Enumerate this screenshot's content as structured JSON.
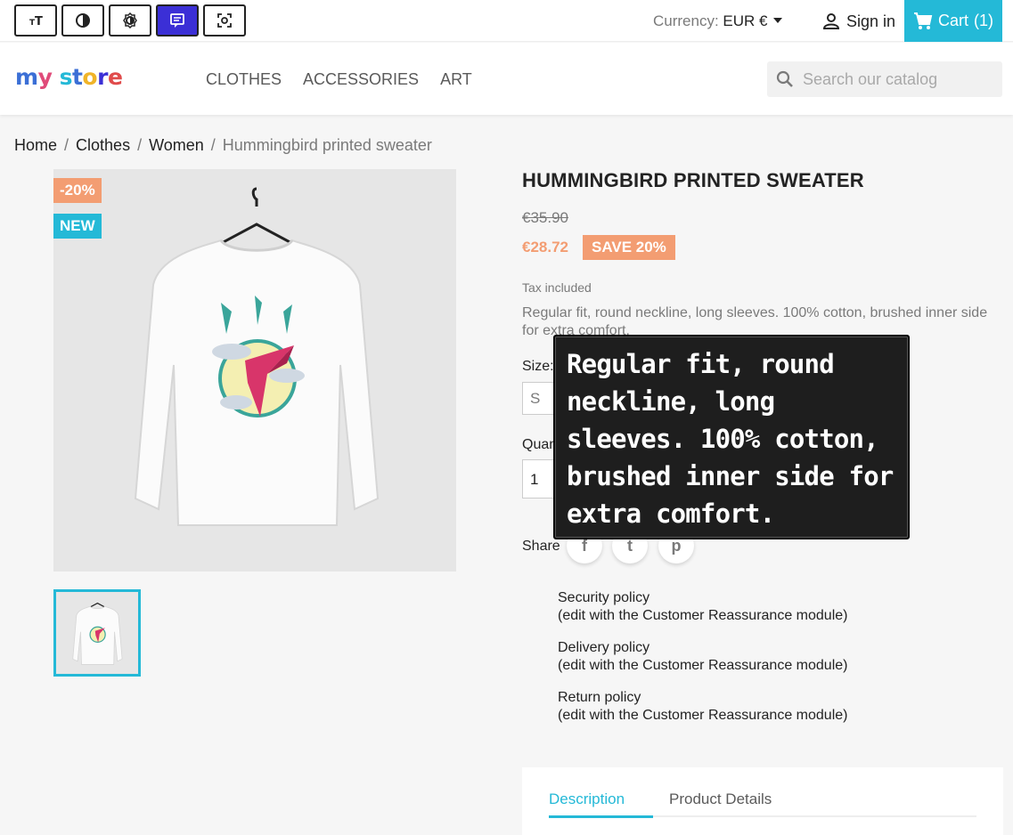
{
  "topbar": {
    "a11y_buttons": [
      {
        "icon": "text-size-icon",
        "active": false
      },
      {
        "icon": "contrast-icon",
        "active": false
      },
      {
        "icon": "brightness-icon",
        "active": false
      },
      {
        "icon": "text-reader-icon",
        "active": true
      },
      {
        "icon": "screen-focus-icon",
        "active": false
      }
    ],
    "currency_label": "Currency:",
    "currency_value": "EUR €",
    "signin": "Sign in",
    "cart": "Cart",
    "cart_count": "(1)"
  },
  "header": {
    "logo_text": "my store",
    "nav": [
      "CLOTHES",
      "ACCESSORIES",
      "ART"
    ],
    "search_placeholder": "Search our catalog"
  },
  "breadcrumb": [
    "Home",
    "Clothes",
    "Women",
    "Hummingbird printed sweater"
  ],
  "product": {
    "flags": {
      "discount": "-20%",
      "new": "NEW"
    },
    "title": "HUMMINGBIRD PRINTED SWEATER",
    "old_price": "€35.90",
    "price": "€28.72",
    "save_badge": "SAVE 20%",
    "tax": "Tax included",
    "short_description": "Regular fit, round neckline, long sleeves. 100% cotton, brushed inner side for extra comfort.",
    "size_label": "Size: S",
    "size_value": "S",
    "quantity_label": "Quantity",
    "quantity_value": "1",
    "share_label": "Share"
  },
  "tooltip": {
    "text": "Regular fit, round neckline, long sleeves. 100% cotton, brushed inner side for extra comfort."
  },
  "reassurance": [
    {
      "title": "Security policy",
      "note": "(edit with the Customer Reassurance module)"
    },
    {
      "title": "Delivery policy",
      "note": "(edit with the Customer Reassurance module)"
    },
    {
      "title": "Return policy",
      "note": "(edit with the Customer Reassurance module)"
    }
  ],
  "tabs": [
    "Description",
    "Product Details"
  ],
  "colors": {
    "accent": "#24b9d7",
    "discount": "#f39d72",
    "active_a11y": "#3b2fd6"
  }
}
